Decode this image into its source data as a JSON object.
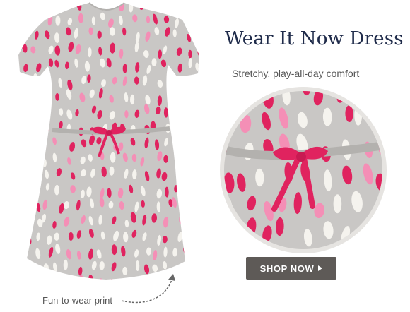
{
  "product": {
    "title": "Wear It Now Dress",
    "subtitle": "Stretchy, play-all-day comfort",
    "cta_label": "SHOP NOW",
    "cta_icon": "play-arrow-icon",
    "caption": "Fun-to-wear print"
  },
  "colors": {
    "fabric": "#c9c7c5",
    "pink_dark": "#e0235f",
    "pink_light": "#f48fb6",
    "white_dot": "#f5f3ee",
    "title": "#1f2b4a",
    "button": "#5e5a57"
  }
}
